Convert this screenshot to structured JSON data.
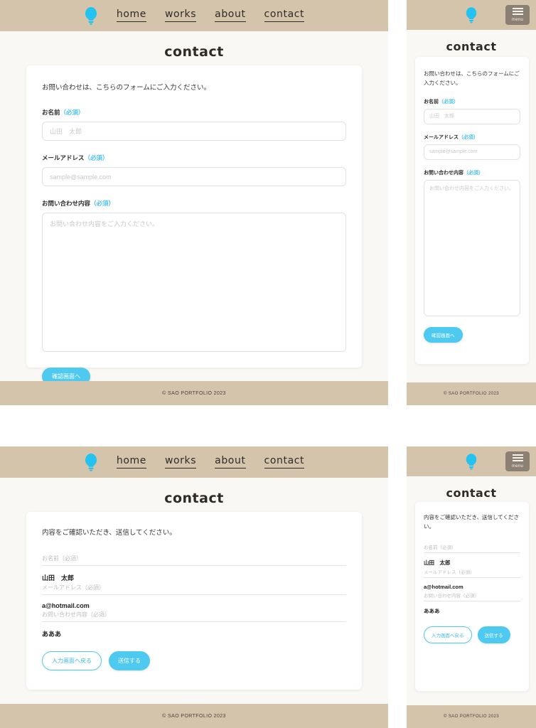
{
  "brand": {
    "logo_icon": "lightbulb-icon",
    "logo_color": "#22c3f0"
  },
  "theme": {
    "header_band": "#d5c4ac",
    "page_bg": "#faf8f5",
    "accent": "#4ec9ef",
    "required_color": "#4ec3ef",
    "hamburger_bg": "#8b8073"
  },
  "nav": {
    "items": [
      {
        "label": "home"
      },
      {
        "label": "works"
      },
      {
        "label": "about"
      },
      {
        "label": "contact"
      }
    ],
    "mobile_menu_label": "menu"
  },
  "page": {
    "title": "contact"
  },
  "input_form": {
    "lead": "お問い合わせは、こちらのフォームにご入力ください。",
    "fields": [
      {
        "label": "お名前",
        "required_mark": "（必須）",
        "value": "",
        "placeholder": "山田　太郎",
        "type": "text"
      },
      {
        "label": "メールアドレス",
        "required_mark": "（必須）",
        "value": "",
        "placeholder": "sample@sample.com",
        "type": "email"
      },
      {
        "label": "お問い合わせ内容",
        "required_mark": "（必須）",
        "value": "",
        "placeholder": "お問い合わせ内容をご入力ください。",
        "type": "textarea"
      }
    ],
    "submit_label": "確認画面へ"
  },
  "confirm_form": {
    "lead": "内容をご確認いただき、送信してください。",
    "rows": [
      {
        "label": "お名前（必須）",
        "value": "山田　太郎"
      },
      {
        "label": "メールアドレス（必須）",
        "value": "a@hotmail.com"
      },
      {
        "label": "お問い合わせ内容（必須）",
        "value": "あああ"
      }
    ],
    "back_label": "入力画面へ戻る",
    "send_label": "送信する"
  },
  "footer": {
    "copyright": "© SAO PORTFOLIO 2023"
  }
}
